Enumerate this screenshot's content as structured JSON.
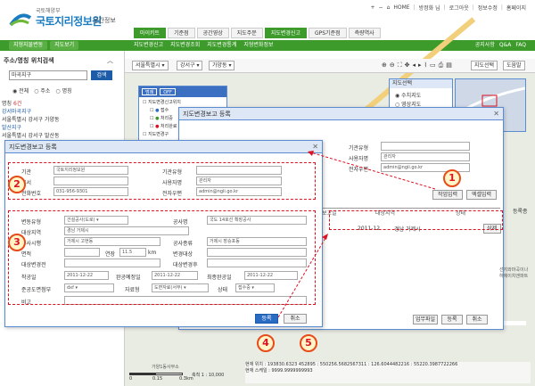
{
  "header": {
    "logo_sub": "국토해양부",
    "logo_main": "국토지리정보원",
    "logo_tag": "공간정보",
    "util": [
      "HOME",
      "방정화 님",
      "로그아웃",
      "정보수정",
      "홈페이지"
    ],
    "nav_tabs": [
      {
        "label": "마이키트",
        "state": "on"
      },
      {
        "label": "기준점",
        "state": ""
      },
      {
        "label": "공간영상",
        "state": ""
      },
      {
        "label": "지도주문",
        "state": ""
      },
      {
        "label": "지도변경신고",
        "state": "sel"
      },
      {
        "label": "GPS기준점",
        "state": ""
      },
      {
        "label": "측량역사",
        "state": ""
      }
    ],
    "sub_left": [
      "지형지물변동",
      "지도보기"
    ],
    "sub_nav": [
      "지도변경신고",
      "지도변경조회",
      "지도변경통계",
      "지형변화정보"
    ],
    "sub_right": [
      "공지사항",
      "Q&A",
      "FAQ"
    ]
  },
  "left_panel": {
    "title": "주소/명칭 위치검색",
    "search_value": "마곡지구",
    "search_button": "검색",
    "radios": [
      "전체",
      "주소",
      "명칭"
    ],
    "results_title": "명칭 ",
    "results_count": "6건",
    "results": [
      {
        "name": "강서마곡지구",
        "addr": "서울특별시 강서구 가양동"
      },
      {
        "name": "발산지구",
        "addr": "서울특별시 강서구 발산동"
      }
    ]
  },
  "map_toolbar": {
    "selects": [
      "서울특별시",
      "강서구",
      "가양동"
    ],
    "right_buttons": [
      "지도선택",
      "도움말"
    ]
  },
  "legend": {
    "button_legend": "범례",
    "button_off": "OFF",
    "items": [
      "지도변경신고위치",
      "접수",
      "처리중",
      "처리완료",
      "지도변경구"
    ]
  },
  "right_panel": {
    "title": "지도선택",
    "options": [
      "수치지도",
      "영상지도"
    ]
  },
  "back_dialog": {
    "title": "지도변경보고 등록",
    "labels": [
      "기관유형",
      "사용자명",
      "전자우편"
    ],
    "values": [
      "",
      "관리자",
      "admin@ngii.go.kr"
    ],
    "buttons": [
      "작업입력",
      "엑셀입력"
    ],
    "table_head": [
      "보고일",
      "대상지역",
      "상태"
    ],
    "table_row": [
      "2011-12",
      "경남 거제시",
      "삭제"
    ],
    "bottom_buttons": [
      "업무파일",
      "등록",
      "취소"
    ],
    "side_label": "등록종"
  },
  "front_dialog": {
    "title": "지도변경보고 등록",
    "org": {
      "label": "기관",
      "value": "국토지리정보원"
    },
    "org_type": {
      "label": "기관유형",
      "value": ""
    },
    "dept": {
      "label": "부서",
      "value": ""
    },
    "user": {
      "label": "사용자명",
      "value": "관리자"
    },
    "phone": {
      "label": "전화번호",
      "value": "031-956-9301"
    },
    "email": {
      "label": "전자우편",
      "value": "admin@ngii.go.kr"
    },
    "change_type": {
      "label": "변동유형",
      "value": "건설공사(도로)"
    },
    "project": {
      "label": "공사명",
      "value": "국도 14호선 확장공사"
    },
    "area": {
      "label": "대상지역",
      "value": "경남 거제시"
    },
    "client": {
      "label": "공사시행",
      "value": "거제시 고현동"
    },
    "contractor": {
      "label": "공사종류",
      "value": "거제시 장승포동"
    },
    "size": {
      "label": "면적",
      "value": ""
    },
    "length_label": "연장",
    "length_value": "11.5",
    "length_unit": "km",
    "target_label": "변경대상",
    "target_value": "",
    "area2": {
      "label": "대상변경전",
      "value": ""
    },
    "area3": {
      "label": "대상변경후",
      "value": ""
    },
    "start": {
      "label": "착공일",
      "value": "2011-12-22"
    },
    "complete": {
      "label": "완공예정일",
      "value": "2011-12-22"
    },
    "final": {
      "label": "최종완공일",
      "value": "2011-12-22"
    },
    "file": {
      "label": "준공도면첨부",
      "value": "dxf"
    },
    "data_type": {
      "label": "자료형",
      "value": "도면자료(서부)"
    },
    "status": {
      "label": "상태",
      "value": "접수중"
    },
    "note": {
      "label": "비고",
      "value": ""
    },
    "buttons": [
      "등록",
      "취소"
    ]
  },
  "callouts": [
    "1",
    "2",
    "3",
    "4",
    "5"
  ],
  "map_text": {
    "scale_labels": [
      "0",
      "0.15",
      "0.3km"
    ],
    "scale_title": "축척 1 : 10,000",
    "coord_line1": "현재 위치 : 193830.6323 452895 : 550256.5682567311 : 126.6044482216 : 55220.3987722266",
    "coord_line2": "현재 스케일 : 9999.9999999993",
    "place1": "가양1동사무소",
    "place2": "선지와마곡이나",
    "place3": "하에이치앤파트"
  },
  "colors": {
    "brand": "#3d9b2c",
    "dialog_border": "#5b8bd0",
    "accent_red": "#d12"
  }
}
